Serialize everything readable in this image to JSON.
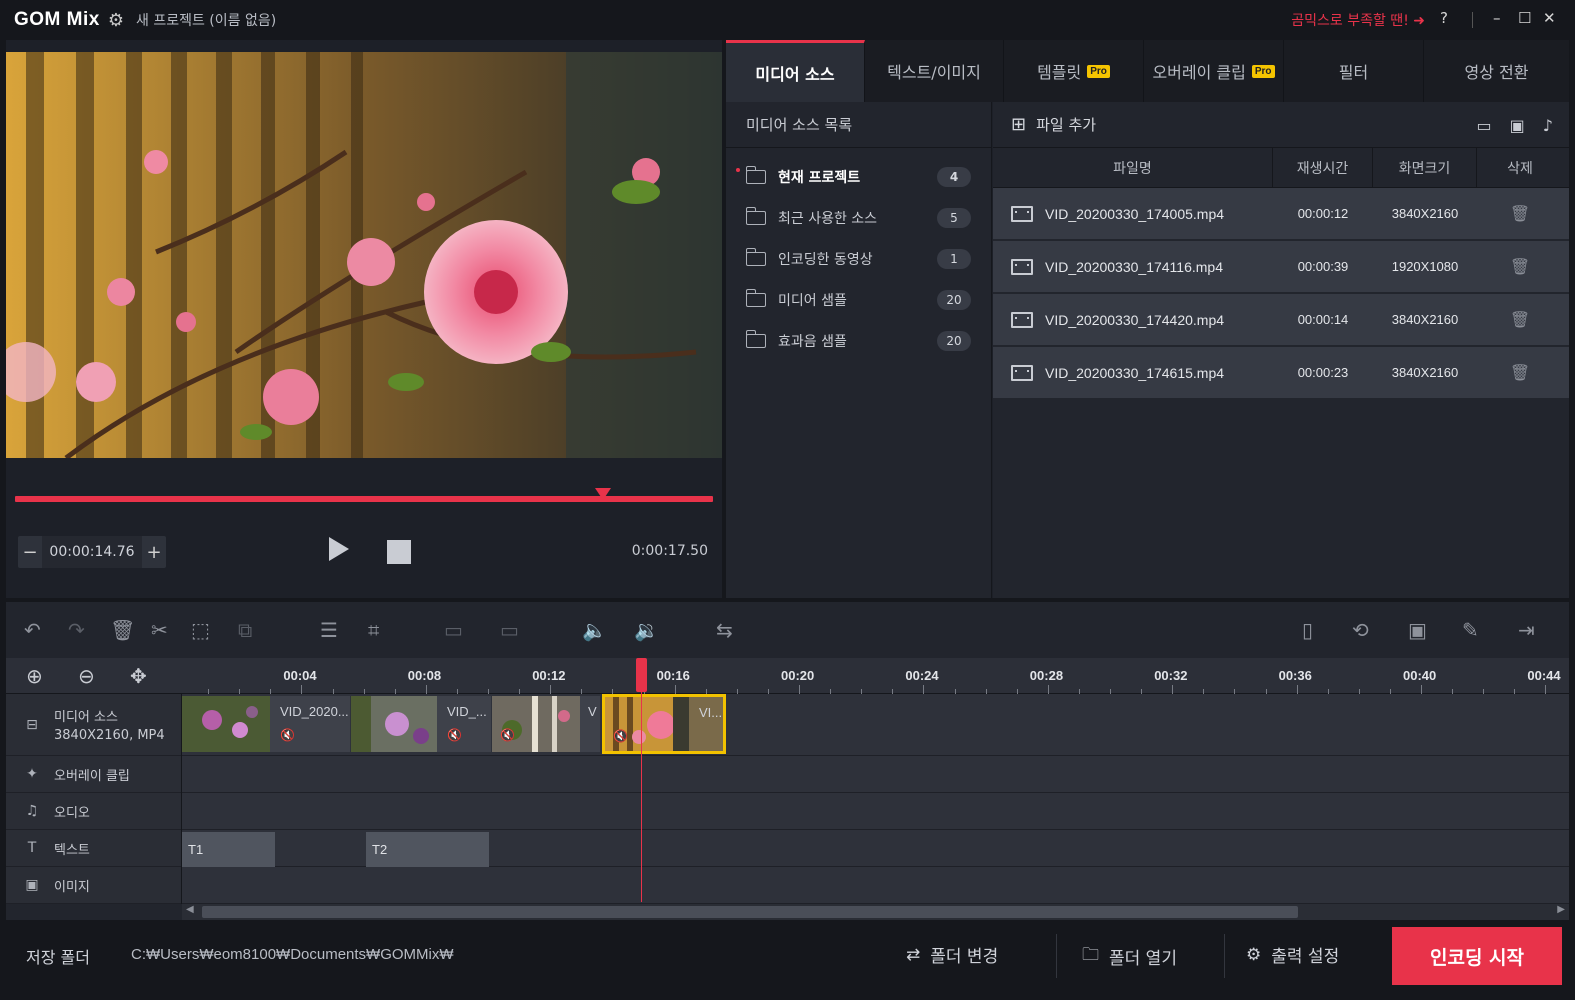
{
  "titlebar": {
    "logo": "GOM Mix",
    "project_title": "새 프로젝트 (이름 없음)",
    "promo": "곰믹스로 부족할 땐!",
    "help": "?"
  },
  "preview": {
    "current_time": "00:00:14.76",
    "total_time": "0:00:17.50",
    "progress_fraction": 0.843
  },
  "tabs": [
    {
      "label": "미디어 소스",
      "pro": ""
    },
    {
      "label": "텍스트/이미지",
      "pro": ""
    },
    {
      "label": "템플릿",
      "pro": "Pro"
    },
    {
      "label": "오버레이 클립",
      "pro": "Pro"
    },
    {
      "label": "필터",
      "pro": ""
    },
    {
      "label": "영상 전환",
      "pro": ""
    }
  ],
  "source_list": {
    "header": "미디어 소스 목록",
    "items": [
      {
        "label": "현재 프로젝트",
        "count": "4"
      },
      {
        "label": "최근 사용한 소스",
        "count": "5"
      },
      {
        "label": "인코딩한 동영상",
        "count": "1"
      },
      {
        "label": "미디어 샘플",
        "count": "20"
      },
      {
        "label": "효과음 샘플",
        "count": "20"
      }
    ]
  },
  "files": {
    "add_label": "파일 추가",
    "columns": {
      "name": "파일명",
      "duration": "재생시간",
      "size": "화면크기",
      "delete": "삭제"
    },
    "rows": [
      {
        "name": "VID_20200330_174005.mp4",
        "duration": "00:00:12",
        "size": "3840X2160"
      },
      {
        "name": "VID_20200330_174116.mp4",
        "duration": "00:00:39",
        "size": "1920X1080"
      },
      {
        "name": "VID_20200330_174420.mp4",
        "duration": "00:00:14",
        "size": "3840X2160"
      },
      {
        "name": "VID_20200330_174615.mp4",
        "duration": "00:00:23",
        "size": "3840X2160"
      }
    ]
  },
  "timeline": {
    "ticks": [
      "00:04",
      "00:08",
      "00:12",
      "00:16",
      "00:20",
      "00:24",
      "00:28",
      "00:32",
      "00:36",
      "00:40",
      "00:44"
    ],
    "tracks": {
      "media": "미디어 소스",
      "media_info": "3840X2160, MP4",
      "overlay": "오버레이 클립",
      "audio": "오디오",
      "text": "텍스트",
      "image": "이미지"
    },
    "clips": [
      {
        "label": "VID_2020..."
      },
      {
        "label": "VID_..."
      },
      {
        "label": "V"
      },
      {
        "label": "VI..."
      }
    ],
    "text_clips": [
      "T1",
      "T2"
    ]
  },
  "bottom": {
    "folder_label": "저장 폴더",
    "folder_path": "C:₩Users₩eom8100₩Documents₩GOMMix₩",
    "change_folder": "폴더 변경",
    "open_folder": "폴더 열기",
    "output_settings": "출력 설정",
    "encode": "인코딩 시작"
  },
  "colors": {
    "accent": "#e8334a",
    "pro_badge": "#f5c400",
    "selected_clip": "#f2c200"
  }
}
